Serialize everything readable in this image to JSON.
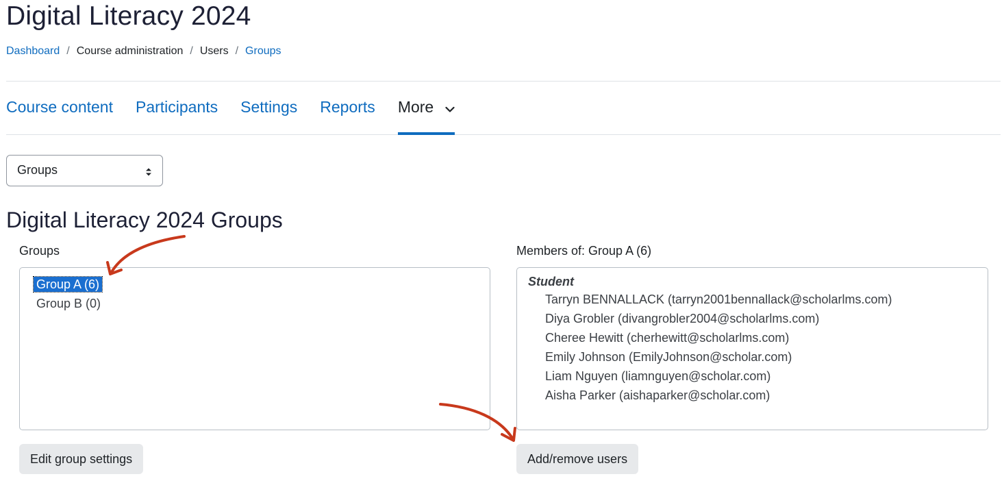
{
  "page": {
    "course_title": "Digital Literacy 2024",
    "section_title": "Digital Literacy 2024 Groups"
  },
  "breadcrumb": {
    "items": [
      {
        "label": "Dashboard",
        "link": true
      },
      {
        "label": "Course administration",
        "link": false
      },
      {
        "label": "Users",
        "link": false
      },
      {
        "label": "Groups",
        "link": true
      }
    ],
    "separator": "/"
  },
  "nav": {
    "tabs": [
      {
        "label": "Course content",
        "active": false
      },
      {
        "label": "Participants",
        "active": false
      },
      {
        "label": "Settings",
        "active": false
      },
      {
        "label": "Reports",
        "active": false
      },
      {
        "label": "More",
        "active": true,
        "icon": "chevron-down-icon"
      }
    ]
  },
  "select": {
    "selected": "Groups",
    "icon": "sort-arrows-icon"
  },
  "groups_panel": {
    "label": "Groups",
    "options": [
      {
        "label": "Group A (6)",
        "selected": true
      },
      {
        "label": "Group B (0)",
        "selected": false
      }
    ]
  },
  "members_panel": {
    "label": "Members of: Group A (6)",
    "role": "Student",
    "members": [
      "Tarryn BENNALLACK (tarryn2001bennallack@scholarlms.com)",
      "Diya Grobler (divangrobler2004@scholarlms.com)",
      "Cheree Hewitt (cherhewitt@scholarlms.com)",
      "Emily Johnson (EmilyJohnson@scholar.com)",
      "Liam Nguyen (liamnguyen@scholar.com)",
      "Aisha Parker (aishaparker@scholar.com)"
    ]
  },
  "buttons": {
    "edit_group_settings": "Edit group settings",
    "add_remove_users": "Add/remove users"
  },
  "colors": {
    "link": "#0f6cbf",
    "title": "#1d2035",
    "selection": "#1a6fd0",
    "annotation_arrow": "#c8391c",
    "button_bg": "#e7e9eb"
  }
}
